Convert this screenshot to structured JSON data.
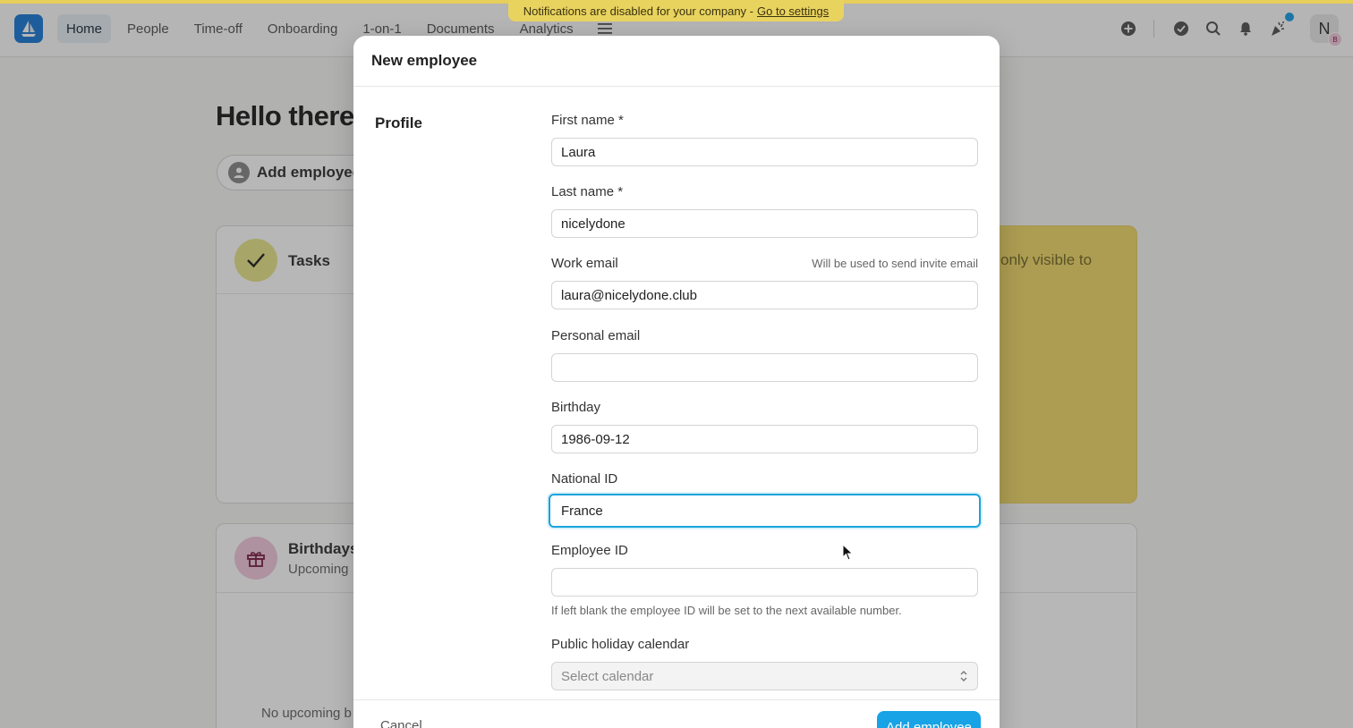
{
  "banner": {
    "text": "Notifications are disabled for your company -",
    "link": "Go to settings"
  },
  "nav": {
    "items": [
      {
        "label": "Home",
        "active": true
      },
      {
        "label": "People"
      },
      {
        "label": "Time-off"
      },
      {
        "label": "Onboarding"
      },
      {
        "label": "1-on-1"
      },
      {
        "label": "Documents"
      },
      {
        "label": "Analytics"
      }
    ]
  },
  "header": {
    "icons": [
      "plus-circle-icon",
      "check-circle-icon",
      "search-icon",
      "bell-icon",
      "celebration-icon"
    ],
    "avatar_initial": "N",
    "avatar_badge": "B"
  },
  "home": {
    "greeting": "Hello there,",
    "add_employee_label": "Add employee",
    "tasks_title": "Tasks",
    "yellow_card_text": "only visible to",
    "birthdays_title": "Birthdays",
    "birthdays_sub": "Upcoming",
    "birthdays_empty": "No upcoming b"
  },
  "modal": {
    "title": "New employee",
    "section": "Profile",
    "fields": {
      "first_name": {
        "label": "First name *",
        "value": "Laura"
      },
      "last_name": {
        "label": "Last name *",
        "value": "nicelydone"
      },
      "work_email": {
        "label": "Work email",
        "hint": "Will be used to send invite email",
        "value": "laura@nicelydone.club"
      },
      "personal_email": {
        "label": "Personal email",
        "value": ""
      },
      "birthday": {
        "label": "Birthday",
        "value": "1986-09-12"
      },
      "national_id": {
        "label": "National ID",
        "value": "France"
      },
      "employee_id": {
        "label": "Employee ID",
        "value": "",
        "help": "If left blank the employee ID will be set to the next available number."
      },
      "holiday_calendar": {
        "label": "Public holiday calendar",
        "placeholder": "Select calendar"
      }
    },
    "cancel_label": "Cancel",
    "submit_label": "Add employee"
  },
  "colors": {
    "accent": "#17a3e6",
    "banner": "#e9d35f",
    "logo": "#1e7bd6"
  }
}
